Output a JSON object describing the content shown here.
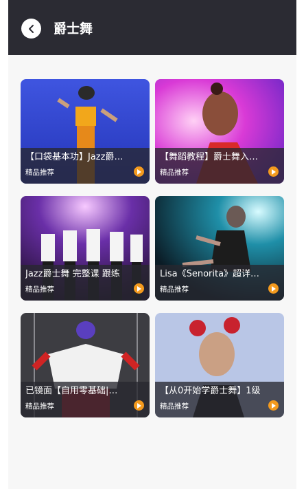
{
  "header": {
    "title": "爵士舞",
    "back_icon": "chevron-left-icon"
  },
  "cards": [
    {
      "title": "【口袋基本功】Jazz爵…",
      "tag": "精品推荐"
    },
    {
      "title": "【舞蹈教程】爵士舞入…",
      "tag": "精品推荐"
    },
    {
      "title": "Jazz爵士舞 完整课 跟练",
      "tag": "精品推荐"
    },
    {
      "title": "Lisa《Senorita》超详…",
      "tag": "精品推荐"
    },
    {
      "title": "已镜面【自用零基础|…",
      "tag": "精品推荐"
    },
    {
      "title": "【从0开始学爵士舞】1级",
      "tag": "精品推荐"
    }
  ],
  "colors": {
    "header_bg": "#2b2b33",
    "play_accent": "#f39a1e",
    "page_bg": "#f7f7f7"
  }
}
